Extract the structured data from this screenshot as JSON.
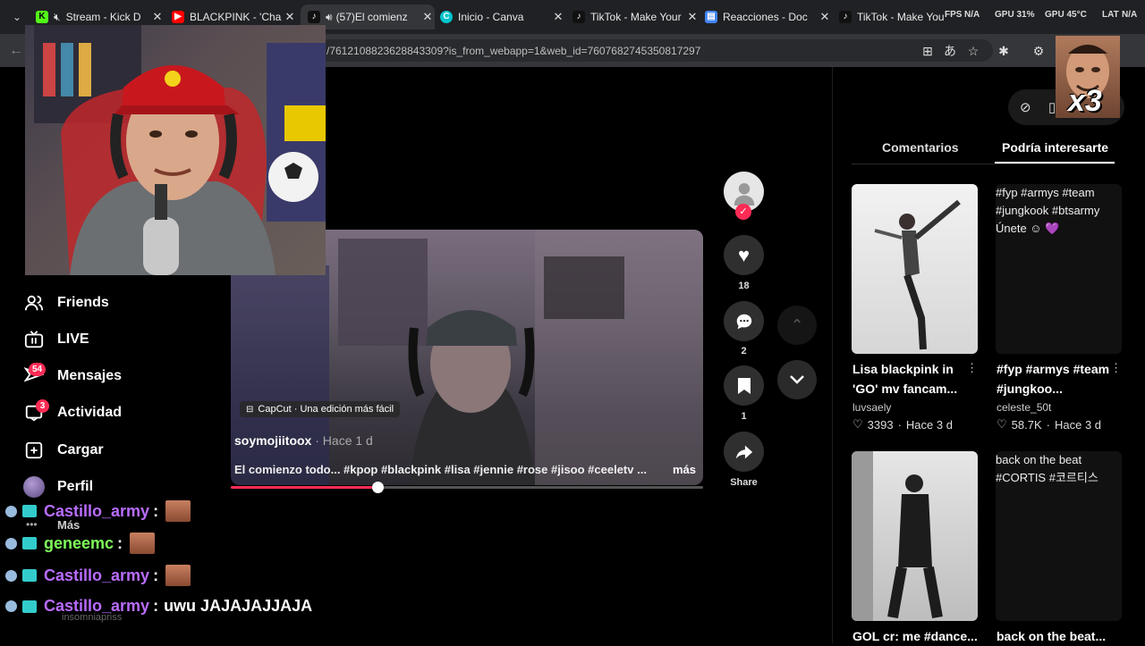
{
  "browser": {
    "tabs": [
      {
        "title": "Stream - Kick D",
        "fav": "K",
        "color": "#53fc18",
        "audio": true
      },
      {
        "title": "BLACKPINK - 'Cha",
        "fav": "▶",
        "color": "#ff0000",
        "audio": false
      },
      {
        "title": "(57)El comienz",
        "fav": "♪",
        "color": "#111111",
        "audio": true
      },
      {
        "title": "Inicio - Canva",
        "fav": "C",
        "color": "#00c4cc",
        "audio": false
      },
      {
        "title": "TikTok - Make Your",
        "fav": "♪",
        "color": "#111111",
        "audio": false
      },
      {
        "title": "Reacciones - Doc",
        "fav": "▤",
        "color": "#4285f4",
        "audio": false
      },
      {
        "title": "TikTok - Make Your",
        "fav": "♪",
        "color": "#111111",
        "audio": false
      }
    ],
    "perf": {
      "fps": "FPS",
      "fps_val": "N/A",
      "gpu": "GPU 31%",
      "gpu_temp": "GPU 45°C",
      "lat": "LAT",
      "lat_val": "N/A"
    },
    "url": "/7612108823628843309?is_from_webapp=1&web_id=7607682745350817297"
  },
  "sidebar": {
    "items": [
      {
        "label": "Friends",
        "icon": "friends-icon"
      },
      {
        "label": "LIVE",
        "icon": "live-icon"
      },
      {
        "label": "Mensajes",
        "icon": "messages-icon",
        "badge": "54"
      },
      {
        "label": "Actividad",
        "icon": "activity-icon",
        "badge": "3"
      },
      {
        "label": "Cargar",
        "icon": "upload-icon"
      },
      {
        "label": "Perfil",
        "icon": "avatar"
      }
    ],
    "more": "Más"
  },
  "video": {
    "promo": "CapCut · Una edición más fácil",
    "author": "soymojiitoox",
    "time": "· Hace 1 d",
    "caption": "El comienzo todo... #kpop #blackpink #lisa #jennie #rose #jisoo #ceeletv ...",
    "more": "más",
    "progress": 0.31
  },
  "actions": {
    "likes": "18",
    "comments": "2",
    "saves": "1",
    "share": "Share"
  },
  "panel": {
    "tabs": [
      "Comentarios",
      "Podría interesarte"
    ],
    "active_tab": 1,
    "cards": [
      {
        "title": "Lisa blackpink in 'GO' mv fancam...",
        "user": "luvsaely",
        "likes": "3393",
        "time": "Hace 3 d"
      },
      {
        "alt": "#fyp #armys #team #jungkook #btsarmy Únete ☺ 💜",
        "title": "#fyp #armys #team #jungkoo...",
        "user": "celeste_50t",
        "likes": "58.7K",
        "time": "Hace 3 d"
      },
      {
        "title": "GOL cr: me #dance..."
      },
      {
        "alt": "back on the beat #CORTIS #코르티스",
        "title": "back on the beat..."
      }
    ]
  },
  "overlay": {
    "multiplier": "x3",
    "chat": [
      {
        "user": "Castillo_army",
        "sep": ":",
        "msg": "",
        "color": "#b86cff",
        "emote": true
      },
      {
        "user": "geneemc",
        "sep": ":",
        "msg": "",
        "color": "#7fff5a",
        "emote": true
      },
      {
        "user": "Castillo_army",
        "sep": ":",
        "msg": "",
        "color": "#b86cff",
        "emote": true
      },
      {
        "user": "Castillo_army",
        "sep": ":",
        "msg": "uwu JAJAJAJJAJA",
        "color": "#b86cff",
        "emote": false
      }
    ],
    "ghost_user": "insomniapriss"
  }
}
